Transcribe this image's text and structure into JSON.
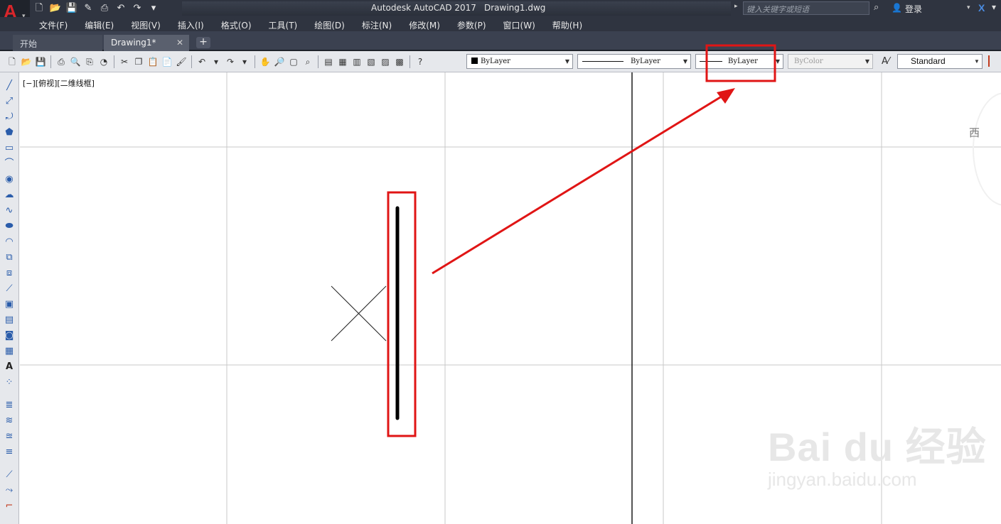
{
  "title_bar": {
    "app_logo": "A",
    "app_title": "Autodesk AutoCAD 2017",
    "document": "Drawing1.dwg",
    "search_placeholder": "键入关键字或短语",
    "login_label": "登录",
    "qat_icons": [
      "new-icon",
      "open-icon",
      "save-icon",
      "saveas-icon",
      "plot-icon",
      "undo-icon",
      "redo-icon",
      "customize-icon"
    ]
  },
  "menu": {
    "items": [
      "文件(F)",
      "编辑(E)",
      "视图(V)",
      "插入(I)",
      "格式(O)",
      "工具(T)",
      "绘图(D)",
      "标注(N)",
      "修改(M)",
      "参数(P)",
      "窗口(W)",
      "帮助(H)"
    ]
  },
  "tabs": [
    {
      "label": "开始"
    },
    {
      "label": "Drawing1*"
    }
  ],
  "toolbar": {
    "color_value": "ByLayer",
    "linetype_value": "ByLayer",
    "lineweight_value": "ByLayer",
    "plotstyle_value": "ByColor",
    "textstyle_value": "Standard"
  },
  "viewport": {
    "label": "[−][俯视][二维线框]",
    "viewcube_direction": "西"
  },
  "watermark": {
    "logo": "Bai du 经验",
    "url": "jingyan.baidu.com"
  },
  "colors": {
    "accent_red": "#e01515",
    "title_bar_bg": "#2f3440",
    "grid_line": "#c8c8c8"
  }
}
